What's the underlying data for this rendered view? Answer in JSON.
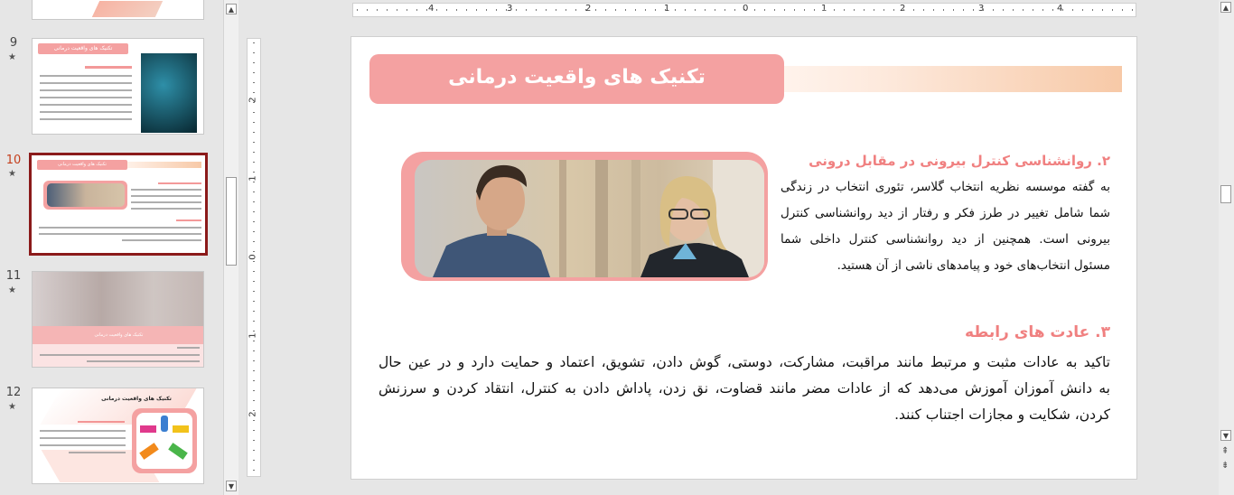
{
  "thumbnails": [
    {
      "number": "9",
      "title": "تکنیک های واقعیت درمانی"
    },
    {
      "number": "10",
      "title": "تکنیک های واقعیت درمانی"
    },
    {
      "number": "11",
      "title": "تکنیک های واقعیت درمانی"
    },
    {
      "number": "12",
      "title": "تکنیک های واقعیت درمانی"
    }
  ],
  "ruler": {
    "h": [
      "4",
      "3",
      "2",
      "1",
      "0",
      "1",
      "2",
      "3",
      "4"
    ],
    "v": [
      "2",
      "1",
      "0",
      "1",
      "2"
    ]
  },
  "slide": {
    "title": "تکنیک های واقعیت درمانی",
    "section2_heading": "۲. روانشناسی کنترل بیرونی در مقابل درونی",
    "section2_lines": [
      "به گفته موسسه نظریه انتخاب گلاسر، تئوری انتخاب در زندگی",
      "شما شامل تغییر در طرز فکر و رفتار از دید روانشناسی کنترل",
      "بیرونی است. همچنین از دید روانشناسی کنترل داخلی شما",
      "مسئول انتخاب‌های خود و پیامدهای ناشی از آن هستید."
    ],
    "section3_heading": "۳. عادت های رابطه",
    "section3_lines": [
      "تاکید به عادات مثبت و مرتبط مانند مراقبت، مشارکت، دوستی، گوش دادن، تشویق، اعتماد و حمایت دارد و در عین حال",
      "به دانش آموزان آموزش می‌دهد که از عادات مضر مانند قضاوت، نق زدن، پاداش دادن به کنترل، انتقاد کردن و سرزنش",
      "کردن، شکایت و مجازات اجتناب کنند."
    ]
  },
  "colors": {
    "accent": "#f4a1a1",
    "heading": "#f08080",
    "selected_border": "#8b1a1a"
  }
}
